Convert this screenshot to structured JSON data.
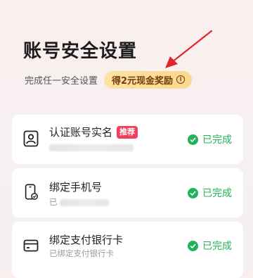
{
  "header": {
    "title": "账号安全设置",
    "subtitle": "完成任一安全设置",
    "reward_label": "得2元现金奖励",
    "reward_info_icon": "info-icon"
  },
  "colors": {
    "success": "#22b359",
    "badge": "#f23d5b",
    "reward_bg": "#fcdc96",
    "arrow": "#e0262b"
  },
  "items": [
    {
      "name": "认证账号实名",
      "badge": "推荐",
      "desc": "",
      "status": "已完成",
      "icon": "id-card-icon"
    },
    {
      "name": "绑定手机号",
      "desc": "已",
      "status": "已完成",
      "icon": "phone-icon"
    },
    {
      "name": "绑定支付银行卡",
      "desc": "已绑定支付银行卡",
      "status": "已完成",
      "icon": "bank-card-icon"
    }
  ]
}
